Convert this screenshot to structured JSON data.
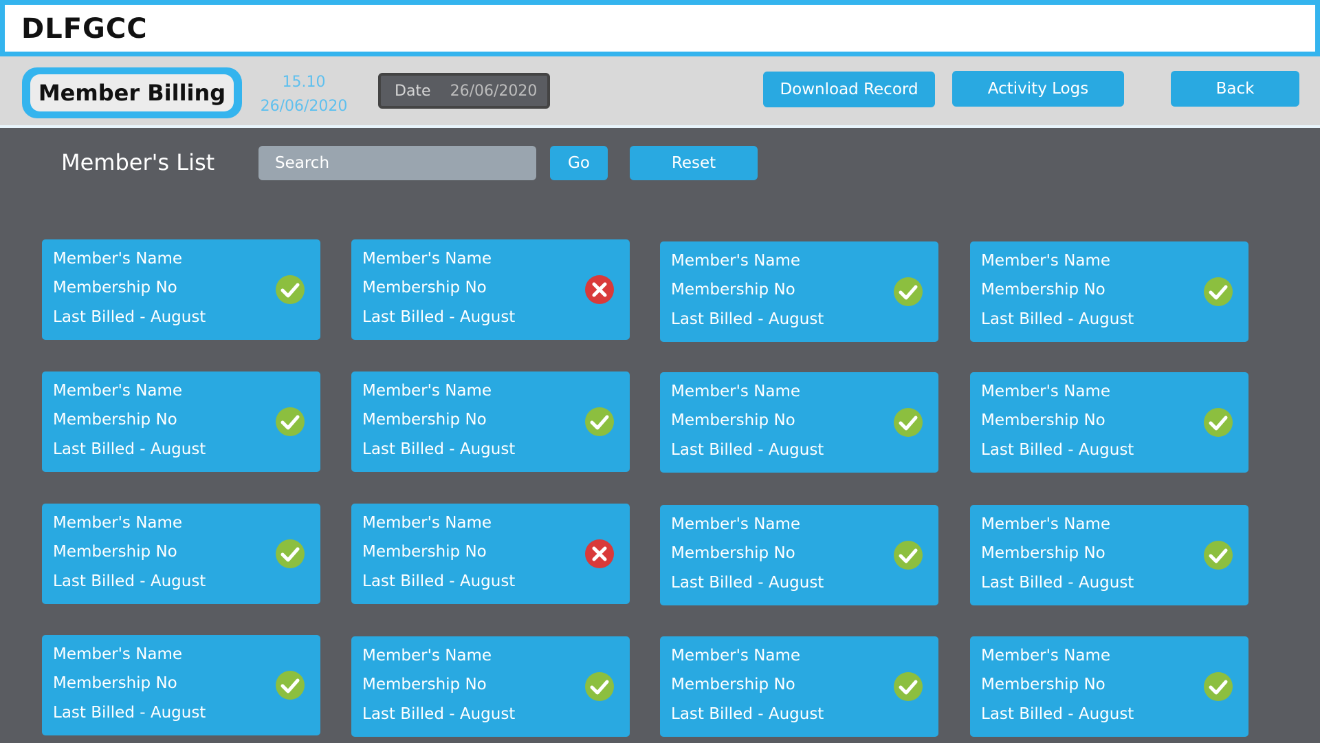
{
  "app": {
    "title": "DLFGCC"
  },
  "header": {
    "page_label": "Member Billing",
    "time": "15.10",
    "date_display": "26/06/2020",
    "date_field": {
      "label": "Date",
      "value": "26/06/2020"
    },
    "buttons": {
      "download": "Download Record",
      "activity": "Activity Logs",
      "back": "Back"
    }
  },
  "list": {
    "title": "Member's List",
    "search_placeholder": "Search",
    "go_label": "Go",
    "reset_label": "Reset"
  },
  "colors": {
    "accent": "#29a9e1",
    "ok": "#8cbf3f",
    "error": "#d93a3a"
  },
  "members": [
    {
      "name": "Member's Name",
      "number": "Membership No",
      "billed": "Last Billed - August",
      "status": "ok"
    },
    {
      "name": "Member's Name",
      "number": "Membership No",
      "billed": "Last Billed - August",
      "status": "error"
    },
    {
      "name": "Member's Name",
      "number": "Membership No",
      "billed": "Last Billed - August",
      "status": "ok"
    },
    {
      "name": "Member's Name",
      "number": "Membership No",
      "billed": "Last Billed - August",
      "status": "ok"
    },
    {
      "name": "Member's Name",
      "number": "Membership No",
      "billed": "Last Billed - August",
      "status": "ok"
    },
    {
      "name": "Member's Name",
      "number": "Membership No",
      "billed": "Last Billed - August",
      "status": "ok"
    },
    {
      "name": "Member's Name",
      "number": "Membership No",
      "billed": "Last Billed - August",
      "status": "ok"
    },
    {
      "name": "Member's Name",
      "number": "Membership No",
      "billed": "Last Billed - August",
      "status": "ok"
    },
    {
      "name": "Member's Name",
      "number": "Membership No",
      "billed": "Last Billed - August",
      "status": "ok"
    },
    {
      "name": "Member's Name",
      "number": "Membership No",
      "billed": "Last Billed - August",
      "status": "error"
    },
    {
      "name": "Member's Name",
      "number": "Membership No",
      "billed": "Last Billed - August",
      "status": "ok"
    },
    {
      "name": "Member's Name",
      "number": "Membership No",
      "billed": "Last Billed - August",
      "status": "ok"
    },
    {
      "name": "Member's Name",
      "number": "Membership No",
      "billed": "Last Billed - August",
      "status": "ok"
    },
    {
      "name": "Member's Name",
      "number": "Membership No",
      "billed": "Last Billed - August",
      "status": "ok"
    },
    {
      "name": "Member's Name",
      "number": "Membership No",
      "billed": "Last Billed - August",
      "status": "ok"
    },
    {
      "name": "Member's Name",
      "number": "Membership No",
      "billed": "Last Billed - August",
      "status": "ok"
    }
  ]
}
